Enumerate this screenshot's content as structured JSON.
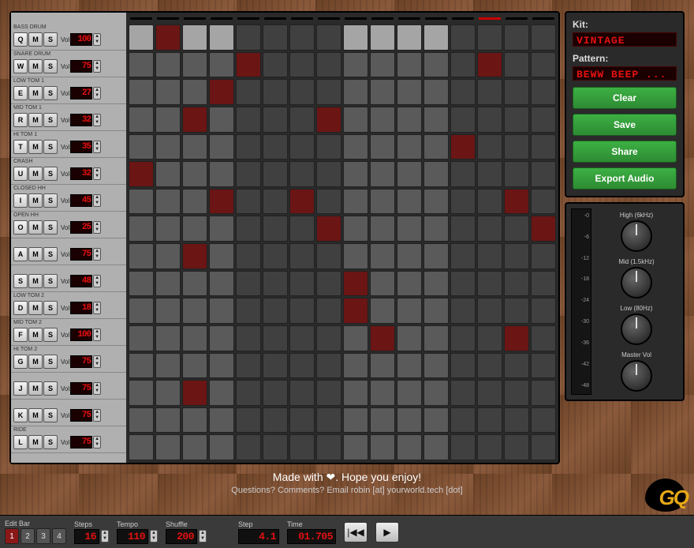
{
  "header": {
    "active_beat": 13
  },
  "tracks": [
    {
      "name": "BASS DRUM",
      "key": "Q",
      "vol": "100",
      "pattern": [
        0,
        1,
        0,
        0,
        0,
        0,
        0,
        0,
        0,
        0,
        0,
        0,
        0,
        0,
        0,
        0
      ]
    },
    {
      "name": "SNARE DRUM",
      "key": "W",
      "vol": "75",
      "pattern": [
        0,
        0,
        0,
        0,
        1,
        0,
        0,
        0,
        0,
        0,
        0,
        0,
        0,
        1,
        0,
        0
      ]
    },
    {
      "name": "LOW TOM 1",
      "key": "E",
      "vol": "27",
      "pattern": [
        0,
        0,
        0,
        1,
        0,
        0,
        0,
        0,
        0,
        0,
        0,
        0,
        0,
        0,
        0,
        0
      ]
    },
    {
      "name": "MID TOM 1",
      "key": "R",
      "vol": "32",
      "pattern": [
        0,
        0,
        1,
        0,
        0,
        0,
        0,
        1,
        0,
        0,
        0,
        0,
        0,
        0,
        0,
        0
      ]
    },
    {
      "name": "HI TOM 1",
      "key": "T",
      "vol": "35",
      "pattern": [
        0,
        0,
        0,
        0,
        0,
        0,
        0,
        0,
        0,
        0,
        0,
        0,
        1,
        0,
        0,
        0
      ]
    },
    {
      "name": "CRASH",
      "key": "U",
      "vol": "32",
      "pattern": [
        1,
        0,
        0,
        0,
        0,
        0,
        0,
        0,
        0,
        0,
        0,
        0,
        0,
        0,
        0,
        0
      ]
    },
    {
      "name": "CLOSED HH",
      "key": "I",
      "vol": "45",
      "pattern": [
        0,
        0,
        0,
        1,
        0,
        0,
        1,
        0,
        0,
        0,
        0,
        0,
        0,
        0,
        1,
        0
      ]
    },
    {
      "name": "OPEN HH",
      "key": "O",
      "vol": "25",
      "pattern": [
        0,
        0,
        0,
        0,
        0,
        0,
        0,
        1,
        0,
        0,
        0,
        0,
        0,
        0,
        0,
        1
      ]
    },
    {
      "name": "",
      "key": "A",
      "vol": "75",
      "pattern": [
        0,
        0,
        1,
        0,
        0,
        0,
        0,
        0,
        0,
        0,
        0,
        0,
        0,
        0,
        0,
        0
      ]
    },
    {
      "name": "",
      "key": "S",
      "vol": "48",
      "pattern": [
        0,
        0,
        0,
        0,
        0,
        0,
        0,
        0,
        1,
        0,
        0,
        0,
        0,
        0,
        0,
        0
      ]
    },
    {
      "name": "LOW TOM 2",
      "key": "D",
      "vol": "18",
      "pattern": [
        0,
        0,
        0,
        0,
        0,
        0,
        0,
        0,
        1,
        0,
        0,
        0,
        0,
        0,
        0,
        0
      ]
    },
    {
      "name": "MID TOM 2",
      "key": "F",
      "vol": "100",
      "pattern": [
        0,
        0,
        0,
        0,
        0,
        0,
        0,
        0,
        0,
        1,
        0,
        0,
        0,
        0,
        1,
        0
      ]
    },
    {
      "name": "HI TOM 2",
      "key": "G",
      "vol": "75",
      "pattern": [
        0,
        0,
        0,
        0,
        0,
        0,
        0,
        0,
        0,
        0,
        0,
        0,
        0,
        0,
        0,
        0
      ]
    },
    {
      "name": "",
      "key": "J",
      "vol": "75",
      "pattern": [
        0,
        0,
        1,
        0,
        0,
        0,
        0,
        0,
        0,
        0,
        0,
        0,
        0,
        0,
        0,
        0
      ]
    },
    {
      "name": "",
      "key": "K",
      "vol": "75",
      "pattern": [
        0,
        0,
        0,
        0,
        0,
        0,
        0,
        0,
        0,
        0,
        0,
        0,
        0,
        0,
        0,
        0
      ]
    },
    {
      "name": "RIDE",
      "key": "L",
      "vol": "75",
      "pattern": [
        0,
        0,
        0,
        0,
        0,
        0,
        0,
        0,
        0,
        0,
        0,
        0,
        0,
        0,
        0,
        0
      ]
    }
  ],
  "side": {
    "kit_label": "Kit:",
    "kit_value": "VINTAGE",
    "pattern_label": "Pattern:",
    "pattern_value": "BEWW BEEP ...",
    "buttons": {
      "clear": "Clear",
      "save": "Save",
      "share": "Share",
      "export": "Export Audio"
    }
  },
  "eq": {
    "meter_ticks": [
      "-0",
      "-6",
      "-12",
      "-18",
      "-24",
      "-30",
      "-36",
      "-42",
      "-48"
    ],
    "knobs": [
      {
        "label": "High (6kHz)"
      },
      {
        "label": "Mid (1.5kHz)"
      },
      {
        "label": "Low (80Hz)"
      },
      {
        "label": "Master Vol"
      }
    ]
  },
  "footer": {
    "line1": "Made with ❤. Hope you enjoy!",
    "line2": "Questions? Comments? Email robin [at] yourworld.tech [dot]"
  },
  "logo": "GQ",
  "transport": {
    "editbar_label": "Edit Bar",
    "bars": [
      "1",
      "2",
      "3",
      "4"
    ],
    "active_bar": 0,
    "steps_label": "Steps",
    "steps": "16",
    "tempo_label": "Tempo",
    "tempo": "110",
    "shuffle_label": "Shuffle",
    "shuffle": "200",
    "step_label": "Step",
    "step": "4.1",
    "time_label": "Time",
    "time": "01.705",
    "vol_lbl": "Vol",
    "m": "M",
    "s": "S"
  }
}
